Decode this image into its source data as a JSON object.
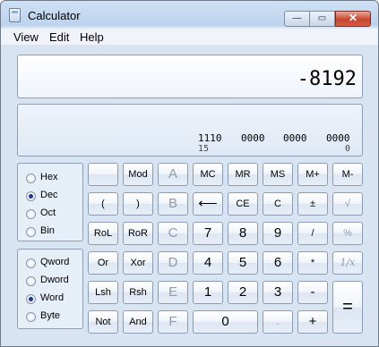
{
  "window": {
    "title": "Calculator"
  },
  "title_buttons": {
    "minimize": "—",
    "maximize": "▭",
    "close": "✕"
  },
  "menu": [
    "View",
    "Edit",
    "Help"
  ],
  "display": {
    "value": "-8192"
  },
  "bits": {
    "row": [
      "1110",
      "0000",
      "0000",
      "0000"
    ],
    "positions": [
      "15",
      "0"
    ]
  },
  "base_options": [
    {
      "label": "Hex",
      "selected": false
    },
    {
      "label": "Dec",
      "selected": true
    },
    {
      "label": "Oct",
      "selected": false
    },
    {
      "label": "Bin",
      "selected": false
    }
  ],
  "word_options": [
    {
      "label": "Qword",
      "selected": false
    },
    {
      "label": "Dword",
      "selected": false
    },
    {
      "label": "Word",
      "selected": true
    },
    {
      "label": "Byte",
      "selected": false
    }
  ],
  "keys": {
    "blank": "",
    "mod": "Mod",
    "a": "A",
    "mc": "MC",
    "mr": "MR",
    "ms": "MS",
    "mplus": "M+",
    "mminus": "M-",
    "lparen": "(",
    "rparen": ")",
    "b": "B",
    "backspace": "⟵",
    "ce": "CE",
    "c": "C",
    "plusminus": "±",
    "sqrt": "√",
    "rol": "RoL",
    "ror": "RoR",
    "c_hex": "C",
    "n7": "7",
    "n8": "8",
    "n9": "9",
    "div": "/",
    "pct": "%",
    "or": "Or",
    "xor": "Xor",
    "d": "D",
    "n4": "4",
    "n5": "5",
    "n6": "6",
    "mul": "*",
    "recip": "1/x",
    "lsh": "Lsh",
    "rsh": "Rsh",
    "e": "E",
    "n1": "1",
    "n2": "2",
    "n3": "3",
    "minus": "-",
    "equals": "=",
    "not": "Not",
    "and": "And",
    "f": "F",
    "n0": "0",
    "dot": ".",
    "plus": "+"
  }
}
